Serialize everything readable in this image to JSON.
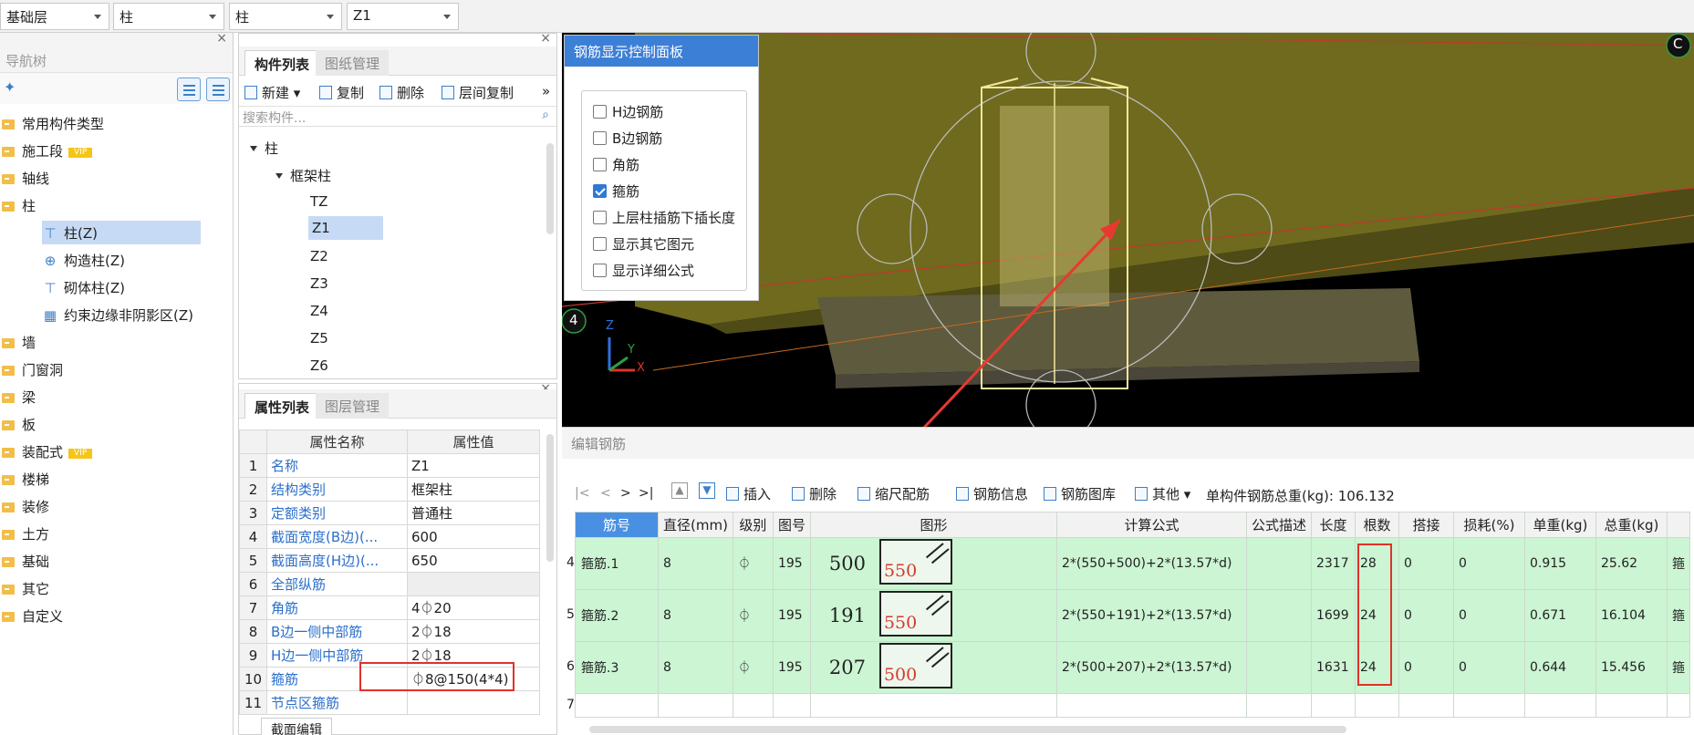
{
  "top_selects": [
    {
      "value": "基础层"
    },
    {
      "value": "柱"
    },
    {
      "value": "柱"
    },
    {
      "value": "Z1"
    }
  ],
  "nav": {
    "title": "导航树",
    "items": [
      {
        "label": "常用构件类型"
      },
      {
        "label": "施工段",
        "badge": "VIP"
      },
      {
        "label": "轴线"
      },
      {
        "label": "柱"
      },
      {
        "label": "柱(Z)"
      },
      {
        "label": "构造柱(Z)"
      },
      {
        "label": "砌体柱(Z)"
      },
      {
        "label": "约束边缘非阴影区(Z)"
      },
      {
        "label": "墙"
      },
      {
        "label": "门窗洞"
      },
      {
        "label": "梁"
      },
      {
        "label": "板"
      },
      {
        "label": "装配式",
        "badge": "VIP"
      },
      {
        "label": "楼梯"
      },
      {
        "label": "装修"
      },
      {
        "label": "土方"
      },
      {
        "label": "基础"
      },
      {
        "label": "其它"
      },
      {
        "label": "自定义"
      }
    ]
  },
  "component_panel": {
    "tabs": [
      "构件列表",
      "图纸管理"
    ],
    "toolbar": [
      "新建",
      "复制",
      "删除",
      "层间复制"
    ],
    "search_placeholder": "搜索构件...",
    "tree": {
      "root": "柱",
      "group": "框架柱",
      "items": [
        "TZ",
        "Z1",
        "Z2",
        "Z3",
        "Z4",
        "Z5",
        "Z6"
      ],
      "selected": "Z1"
    }
  },
  "property_panel": {
    "tabs": [
      "属性列表",
      "图层管理"
    ],
    "headers": [
      "属性名称",
      "属性值"
    ],
    "rows": [
      {
        "n": "1",
        "k": "名称",
        "v": "Z1"
      },
      {
        "n": "2",
        "k": "结构类别",
        "v": "框架柱"
      },
      {
        "n": "3",
        "k": "定额类别",
        "v": "普通柱"
      },
      {
        "n": "4",
        "k": "截面宽度(B边)(...",
        "v": "600"
      },
      {
        "n": "5",
        "k": "截面高度(H边)(...",
        "v": "650"
      },
      {
        "n": "6",
        "k": "全部纵筋",
        "v": ""
      },
      {
        "n": "7",
        "k": "角筋",
        "v": "4⏀20"
      },
      {
        "n": "8",
        "k": "B边一侧中部筋",
        "v": "2⏀18"
      },
      {
        "n": "9",
        "k": "H边一侧中部筋",
        "v": "2⏀18"
      },
      {
        "n": "10",
        "k": "箍筋",
        "v": "⏀8@150(4*4)"
      },
      {
        "n": "11",
        "k": "节点区箍筋",
        "v": ""
      }
    ],
    "bottom_tab": "截面编辑"
  },
  "rebar_panel": {
    "title": "钢筋显示控制面板",
    "options": [
      {
        "label": "H边钢筋",
        "checked": false
      },
      {
        "label": "B边钢筋",
        "checked": false
      },
      {
        "label": "角筋",
        "checked": false
      },
      {
        "label": "箍筋",
        "checked": true
      },
      {
        "label": "上层柱插筋下插长度",
        "checked": false
      },
      {
        "label": "显示其它图元",
        "checked": false
      },
      {
        "label": "显示详细公式",
        "checked": false
      }
    ]
  },
  "view3d": {
    "axis_c": "C",
    "axis_4": "4",
    "axis_z": "Z",
    "axis_y": "Y",
    "axis_x": "X"
  },
  "edit_rebar": {
    "title": "编辑钢筋",
    "toolbar": [
      "插入",
      "删除",
      "缩尺配筋",
      "钢筋信息",
      "钢筋图库",
      "其他"
    ],
    "total_label": "单构件钢筋总重(kg): 106.132",
    "headers": [
      "筋号",
      "直径(mm)",
      "级别",
      "图号",
      "图形",
      "计算公式",
      "公式描述",
      "长度",
      "根数",
      "搭接",
      "损耗(%)",
      "单重(kg)",
      "总重(kg)"
    ],
    "rows": [
      {
        "no": "4",
        "name": "箍筋.1",
        "dia": "8",
        "grade": "⏀",
        "fig": "195",
        "s1": "500",
        "s2": "550",
        "formula": "2*(550+500)+2*(13.57*d)",
        "desc": "",
        "len": "2317",
        "count": "28",
        "lap": "0",
        "loss": "0",
        "unit": "0.915",
        "total": "25.62",
        "extra": "箍"
      },
      {
        "no": "5",
        "name": "箍筋.2",
        "dia": "8",
        "grade": "⏀",
        "fig": "195",
        "s1": "191",
        "s2": "550",
        "formula": "2*(550+191)+2*(13.57*d)",
        "desc": "",
        "len": "1699",
        "count": "24",
        "lap": "0",
        "loss": "0",
        "unit": "0.671",
        "total": "16.104",
        "extra": "箍"
      },
      {
        "no": "6",
        "name": "箍筋.3",
        "dia": "8",
        "grade": "⏀",
        "fig": "195",
        "s1": "207",
        "s2": "500",
        "formula": "2*(500+207)+2*(13.57*d)",
        "desc": "",
        "len": "1631",
        "count": "24",
        "lap": "0",
        "loss": "0",
        "unit": "0.644",
        "total": "15.456",
        "extra": "箍"
      }
    ],
    "empty_row_no": "7"
  },
  "colors": {
    "accent": "#3c7fd6",
    "highlight": "#e0312a",
    "row_green": "#ccf5d3",
    "beam": "#6f6a1e"
  }
}
